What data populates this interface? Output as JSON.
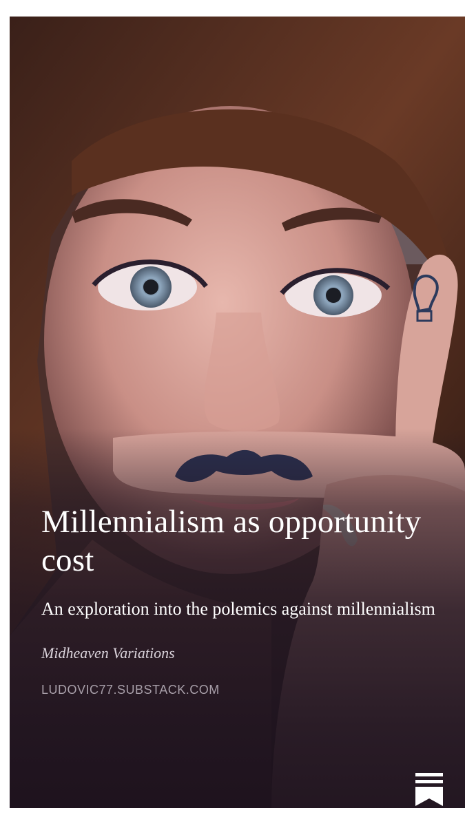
{
  "post": {
    "title": "Millennialism as opportunity cost",
    "subtitle": "An exploration into the polemics against millennialism",
    "publication": "Midheaven Variations",
    "domain": "LUDOVIC77.SUBSTACK.COM"
  },
  "icons": {
    "logo": "substack-logo-icon"
  },
  "colors": {
    "overlay": "#201622",
    "title_text": "#ffffff",
    "domain_text": "#a89fa9"
  }
}
